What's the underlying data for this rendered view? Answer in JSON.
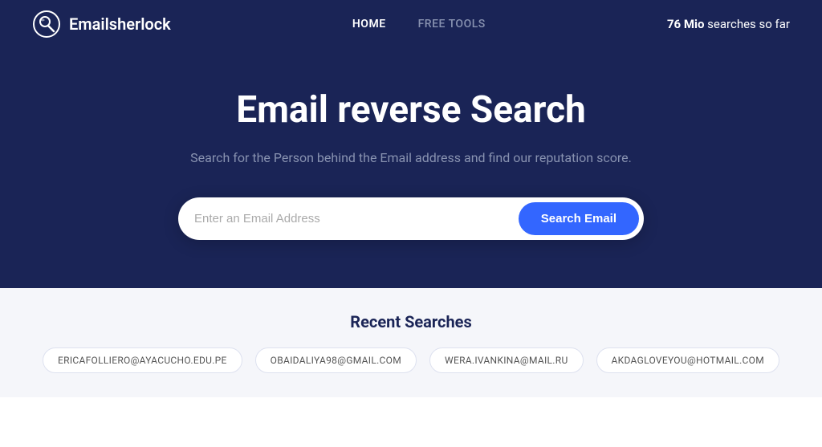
{
  "header": {
    "logo_text": "Emailsherlock",
    "nav": {
      "home_label": "HOME",
      "free_tools_label": "FREE TOOLS"
    },
    "search_count_bold": "76 Mio",
    "search_count_text": " searches so far"
  },
  "hero": {
    "title": "Email reverse Search",
    "subtitle": "Search for the Person behind the Email address and find our reputation score.",
    "input_placeholder": "Enter an Email Address",
    "button_label": "Search Email"
  },
  "recent": {
    "section_title": "Recent Searches",
    "items": [
      {
        "email": "ERICAFOLLIERO@AYACUCHO.EDU.PE"
      },
      {
        "email": "OBAIDALIYA98@GMAIL.COM"
      },
      {
        "email": "WERA.IVANKINA@MAIL.RU"
      },
      {
        "email": "AKDAGLOVEYOU@HOTMAIL.COM"
      }
    ]
  }
}
